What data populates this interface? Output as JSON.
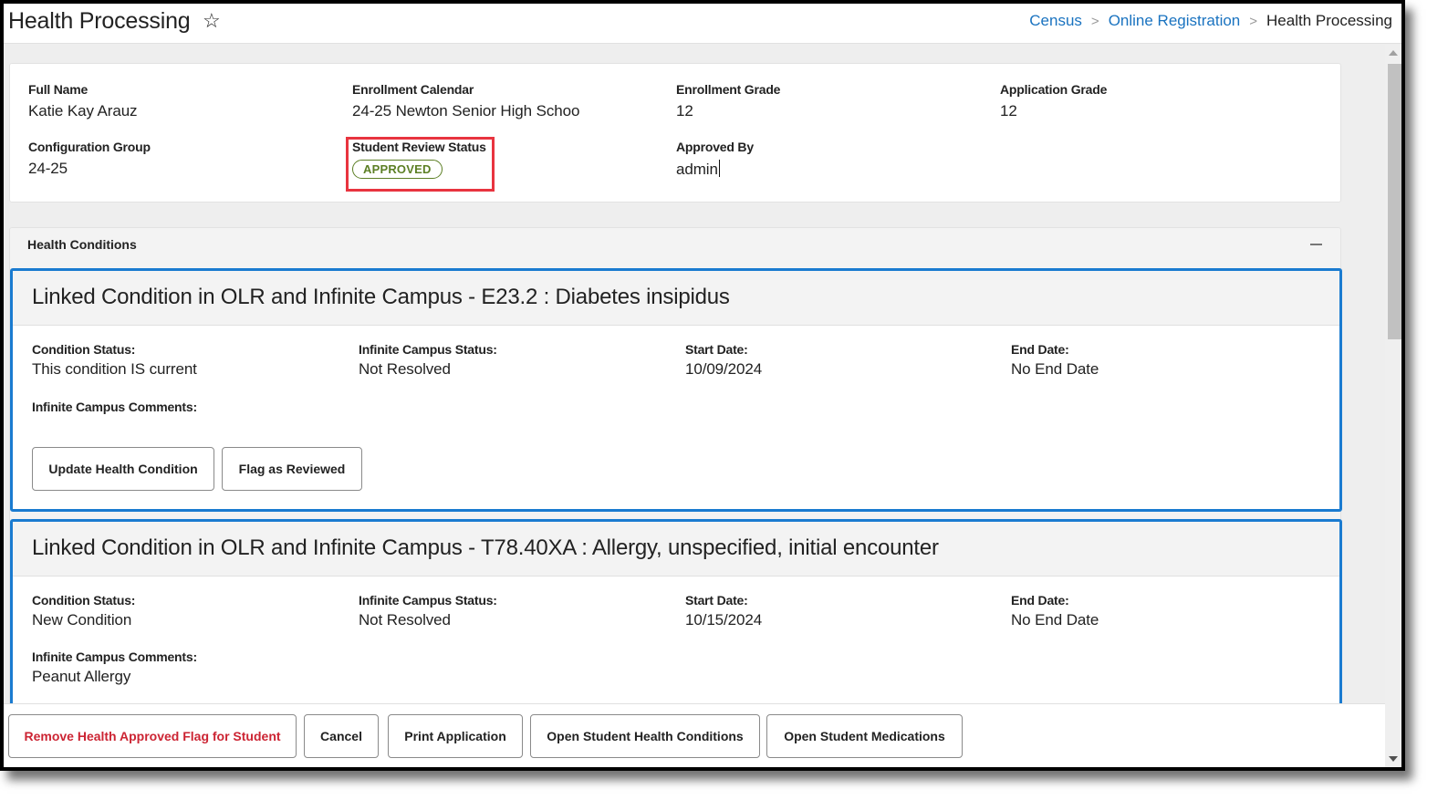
{
  "header": {
    "title": "Health Processing",
    "favorite_icon": "star-outline-icon",
    "breadcrumb": [
      {
        "label": "Census",
        "link": true
      },
      {
        "label": "Online Registration",
        "link": true
      },
      {
        "label": "Health Processing",
        "link": false
      }
    ]
  },
  "summary": {
    "full_name": {
      "label": "Full Name",
      "value": "Katie Kay Arauz"
    },
    "enrollment_calendar": {
      "label": "Enrollment Calendar",
      "value": "24-25 Newton Senior High Schoo"
    },
    "enrollment_grade": {
      "label": "Enrollment Grade",
      "value": "12"
    },
    "application_grade": {
      "label": "Application Grade",
      "value": "12"
    },
    "configuration_group": {
      "label": "Configuration Group",
      "value": "24-25"
    },
    "student_review_status": {
      "label": "Student Review Status",
      "value": "APPROVED",
      "color": "#5c7f24",
      "highlight_color": "#e8343f"
    },
    "approved_by": {
      "label": "Approved By",
      "value": "admin"
    }
  },
  "health_conditions": {
    "title": "Health Conditions",
    "collapse_icon": "minus-icon",
    "accent_color": "#1a7bd0",
    "conditions": [
      {
        "title": "Linked Condition in OLR and Infinite Campus - E23.2 : Diabetes insipidus",
        "condition_status_label": "Condition Status:",
        "condition_status": "This condition IS current",
        "ic_status_label": "Infinite Campus Status:",
        "ic_status": "Not Resolved",
        "start_date_label": "Start Date:",
        "start_date": "10/09/2024",
        "end_date_label": "End Date:",
        "end_date": "No End Date",
        "comments_label": "Infinite Campus Comments:",
        "comments": "",
        "buttons": [
          "Update Health Condition",
          "Flag as Reviewed"
        ]
      },
      {
        "title": "Linked Condition in OLR and Infinite Campus - T78.40XA : Allergy, unspecified, initial encounter",
        "condition_status_label": "Condition Status:",
        "condition_status": "New Condition",
        "ic_status_label": "Infinite Campus Status:",
        "ic_status": "Not Resolved",
        "start_date_label": "Start Date:",
        "start_date": "10/15/2024",
        "end_date_label": "End Date:",
        "end_date": "No End Date",
        "comments_label": "Infinite Campus Comments:",
        "comments": "Peanut Allergy"
      }
    ]
  },
  "actions": {
    "remove_flag": "Remove Health Approved Flag for Student",
    "cancel": "Cancel",
    "print": "Print Application",
    "open_conditions": "Open Student Health Conditions",
    "open_medications": "Open Student Medications",
    "danger_color": "#cc2433"
  }
}
